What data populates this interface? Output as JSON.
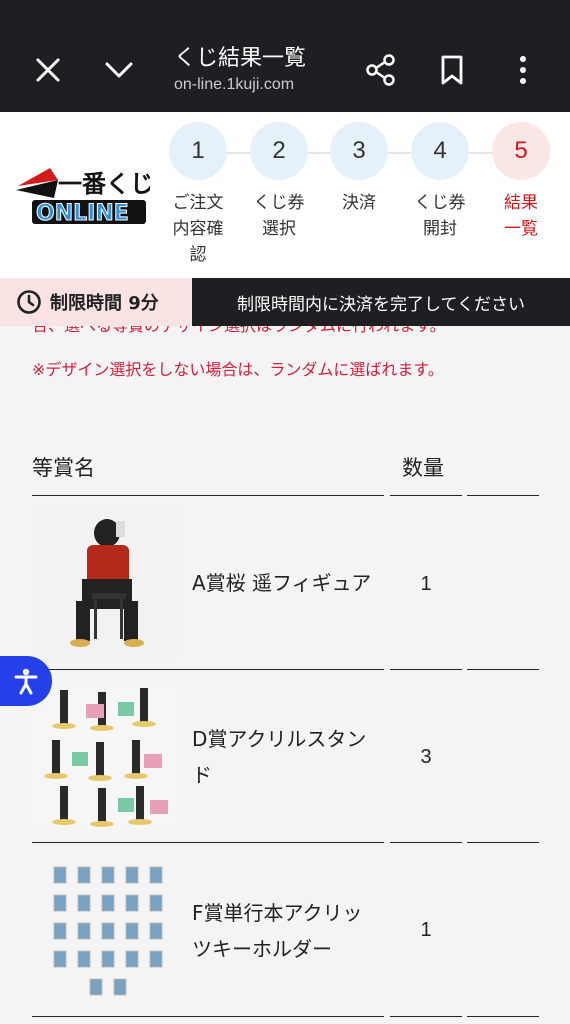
{
  "browser": {
    "page_title": "くじ結果一覧",
    "url": "on-line.1kuji.com"
  },
  "logo": {
    "text_top": "一番くじ",
    "text_bottom": "ONLINE"
  },
  "steps": [
    {
      "number": "1",
      "label": "ご注文\n内容確\n認"
    },
    {
      "number": "2",
      "label": "くじ券\n選択"
    },
    {
      "number": "3",
      "label": "決済"
    },
    {
      "number": "4",
      "label": "くじ券\n開封"
    },
    {
      "number": "5",
      "label": "結果\n一覧"
    }
  ],
  "timer": {
    "label": "制限時間 9分",
    "message": "制限時間内に決済を完了してください"
  },
  "notices": {
    "line1": "合、選べる等賞のデザイン選択はランダムに行われます。",
    "line2": "※デザイン選択をしない場合は、ランダムに選ばれます。"
  },
  "table": {
    "col_prize": "等賞名",
    "col_qty": "数量",
    "rows": [
      {
        "name": "A賞桜 遥フィギュア",
        "qty": "1"
      },
      {
        "name": "D賞アクリルスタンド",
        "qty": "3"
      },
      {
        "name": "F賞単行本アクリッツキーホルダー",
        "qty": "1"
      }
    ]
  },
  "colors": {
    "accent_red": "#cc1a1a",
    "step_bg": "#e5f1f8",
    "dark_bar": "#1d1f22",
    "a11y_blue": "#2540e8"
  }
}
